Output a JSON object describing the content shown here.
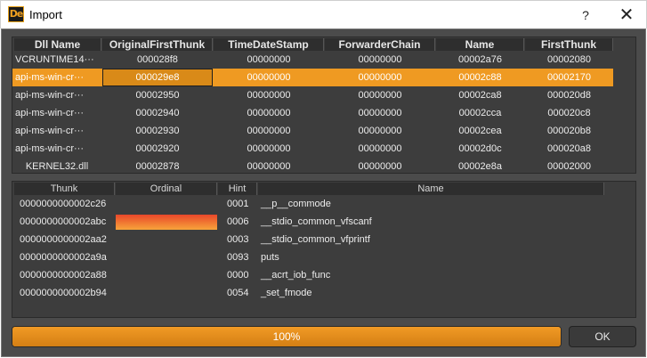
{
  "window": {
    "title": "Import",
    "icon_label": "De",
    "help_label": "?",
    "close_label": "✕"
  },
  "dll_table": {
    "columns": [
      "Dll Name",
      "OriginalFirstThunk",
      "TimeDateStamp",
      "ForwarderChain",
      "Name",
      "FirstThunk"
    ],
    "selected_row": 1,
    "rows": [
      [
        "VCRUNTIME14···",
        "000028f8",
        "00000000",
        "00000000",
        "00002a76",
        "00002080"
      ],
      [
        "api-ms-win-cr···",
        "000029e8",
        "00000000",
        "00000000",
        "00002c88",
        "00002170"
      ],
      [
        "api-ms-win-cr···",
        "00002950",
        "00000000",
        "00000000",
        "00002ca8",
        "000020d8"
      ],
      [
        "api-ms-win-cr···",
        "00002940",
        "00000000",
        "00000000",
        "00002cca",
        "000020c8"
      ],
      [
        "api-ms-win-cr···",
        "00002930",
        "00000000",
        "00000000",
        "00002cea",
        "000020b8"
      ],
      [
        "api-ms-win-cr···",
        "00002920",
        "00000000",
        "00000000",
        "00002d0c",
        "000020a8"
      ],
      [
        "KERNEL32.dll",
        "00002878",
        "00000000",
        "00000000",
        "00002e8a",
        "00002000"
      ]
    ]
  },
  "func_table": {
    "columns": [
      "Thunk",
      "Ordinal",
      "Hint",
      "Name"
    ],
    "rows": [
      [
        "0000000000002c26",
        "",
        "0001",
        "__p__commode"
      ],
      [
        "0000000000002abc",
        "",
        "0006",
        "__stdio_common_vfscanf"
      ],
      [
        "0000000000002aa2",
        "",
        "0003",
        "__stdio_common_vfprintf"
      ],
      [
        "0000000000002a9a",
        "",
        "0093",
        "puts"
      ],
      [
        "0000000000002a88",
        "",
        "0000",
        "__acrt_iob_func"
      ],
      [
        "0000000000002b94",
        "",
        "0054",
        "_set_fmode"
      ]
    ],
    "ordinal_highlight_row": 1
  },
  "progress": {
    "label": "100%",
    "value_percent": 100
  },
  "ok_label": "OK",
  "colors": {
    "selection": "#ef9a22",
    "panel": "#3d3d3d",
    "background": "#4b4b4b"
  }
}
